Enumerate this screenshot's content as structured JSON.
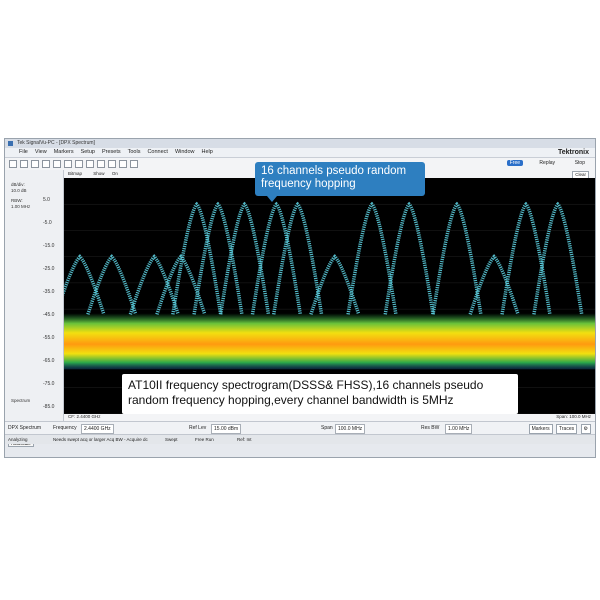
{
  "window": {
    "title": "Tek SignalVu-PC - [DPX Spectrum]",
    "brand": "Tektronix"
  },
  "menu": [
    "File",
    "View",
    "Markers",
    "Setup",
    "Presets",
    "Tools",
    "Connect",
    "Window",
    "Help"
  ],
  "toolbar": {
    "free_label": "Free",
    "replay_label": "Replay",
    "stop_label": "Stop"
  },
  "display_bar": {
    "bitmap_label": "Bitmap",
    "show_label": "Show",
    "on_label": "On",
    "clear_label": "Clear"
  },
  "left_panel": {
    "div_label": "dB/div:",
    "div_value": "10.0 dB",
    "rbw_label": "RBW:",
    "rbw_value": "1.00 MHz",
    "spectrum_label": "Spectrum",
    "autoscale_label": "Autoscale"
  },
  "y_axis": [
    "5.0",
    "-5.0",
    "-15.0",
    "-25.0",
    "-35.0",
    "-45.0",
    "-55.0",
    "-65.0",
    "-75.0",
    "-85.0"
  ],
  "x_axis": {
    "center": "CF: 2.4400 GHz",
    "span": "Span: 100.0 MHz"
  },
  "status": {
    "view_name": "DPX Spectrum",
    "frequency_label": "Frequency",
    "frequency_value": "2.4400 GHz",
    "reflev_label": "Ref Lev",
    "reflev_value": "15.00 dBm",
    "span_label": "Span",
    "span_value": "100.0 MHz",
    "resbw_label": "Res BW",
    "resbw_value": "1.00 MHz",
    "markers_label": "Markers",
    "traces_label": "Traces"
  },
  "bottom_status": {
    "state": "Analyzing",
    "message": "Needs swept acq or larger Acq BW - Acquire dc",
    "swept": "Swept",
    "free_run": "Free Run",
    "ref_int": "Ref: Int"
  },
  "callouts": {
    "top": "16 channels pseudo random frequency hopping",
    "bottom": "AT10II frequency spectrogram(DSSS& FHSS),16 channels pseudo random frequency hopping,every channel bandwidth is 5MHz"
  },
  "chart_data": {
    "type": "area",
    "title": "",
    "xlabel": "",
    "ylabel": "",
    "ylim": [
      -85,
      5
    ],
    "x_range_mhz": [
      2390,
      2490
    ],
    "noise_floor_dbm": -55,
    "hop_peaks": [
      {
        "x": 2393,
        "y": -25
      },
      {
        "x": 2399,
        "y": -25
      },
      {
        "x": 2407,
        "y": -25
      },
      {
        "x": 2412,
        "y": -25
      },
      {
        "x": 2415,
        "y": -5
      },
      {
        "x": 2419,
        "y": -5
      },
      {
        "x": 2424,
        "y": -5
      },
      {
        "x": 2430,
        "y": -5
      },
      {
        "x": 2434,
        "y": -5
      },
      {
        "x": 2441,
        "y": -25
      },
      {
        "x": 2448,
        "y": -5
      },
      {
        "x": 2455,
        "y": -5
      },
      {
        "x": 2464,
        "y": -5
      },
      {
        "x": 2471,
        "y": -25
      },
      {
        "x": 2477,
        "y": -5
      },
      {
        "x": 2483,
        "y": -5
      }
    ],
    "colors": {
      "background": "#000000",
      "trace": "#5fd6e6",
      "floor_hot": "#ff9a10",
      "floor_mid": "#f2e010",
      "floor_cool": "#2aa84a"
    }
  }
}
